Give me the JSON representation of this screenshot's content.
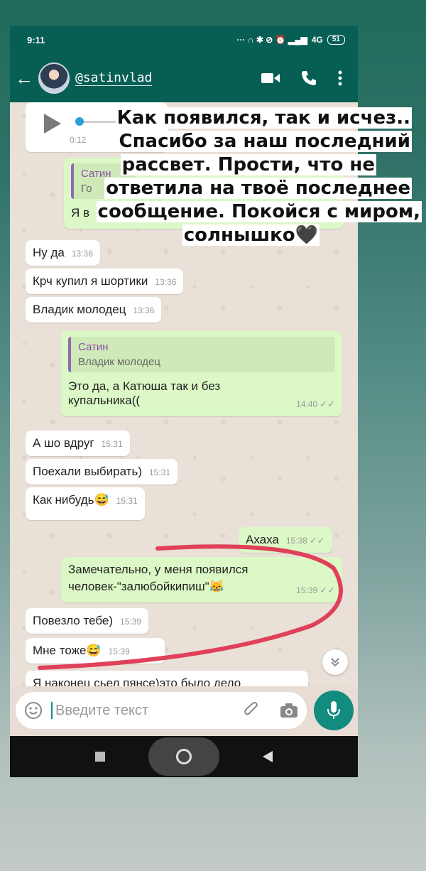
{
  "status": {
    "time": "9:11",
    "network": "4G",
    "battery": "51"
  },
  "header": {
    "contact_name": "@satinvlad"
  },
  "caption": {
    "lines": [
      "Как появился, так и исчез..",
      "Спасибо за наш последний",
      "рассвет. Прости, что не",
      "ответила на твоё последнее",
      "сообщение. Покойся с миром,",
      "солнышко🖤"
    ]
  },
  "voice": {
    "duration": "0:12"
  },
  "partial_quote": {
    "name": "Сатин",
    "snippet": "Го",
    "reply_prefix": "Я в"
  },
  "messages": {
    "m1": {
      "text": "Ну да",
      "time": "13:36"
    },
    "m2": {
      "text": "Крч купил я шортики",
      "time": "13:36"
    },
    "m3": {
      "text": "Владик молодец",
      "time": "13:36"
    },
    "m4": {
      "quote_name": "Сатин",
      "quote_text": "Владик молодец",
      "line1": "Это да, а Катюша так и без",
      "line2": "купальника((",
      "time": "14:40",
      "check": "✓✓"
    },
    "m5": {
      "text": "А шо вдруг",
      "time": "15:31"
    },
    "m6": {
      "text": "Поехали выбирать)",
      "time": "15:31"
    },
    "m7": {
      "text": "Как нибудь😅",
      "time": "15:31"
    },
    "m8": {
      "text": "Ахаха",
      "time": "15:38",
      "check": "✓✓"
    },
    "m9": {
      "line1": "Замечательно, у меня появился",
      "line2": "человек-\"залюбойкипиш\"😹",
      "time": "15:39",
      "check": "✓✓"
    },
    "m10": {
      "text": "Повезло тебе)",
      "time": "15:39"
    },
    "m11": {
      "text": "Мне тоже😅",
      "time": "15:39"
    },
    "m12": {
      "text": "Я наконец сьел пянсе)это было дело"
    }
  },
  "input": {
    "placeholder": "Введите текст"
  },
  "icons": {
    "back": "back-arrow-icon",
    "video": "video-call-icon",
    "phone": "phone-icon",
    "menu": "more-vert-icon",
    "emoji": "emoji-icon",
    "attach": "attach-icon",
    "camera": "camera-icon",
    "mic": "mic-icon",
    "scroll_down": "double-chevron-down-icon",
    "nav_recents": "recents-icon",
    "nav_home": "home-icon",
    "nav_back": "nav-back-icon"
  },
  "colors": {
    "header": "#075e54",
    "outgoing": "#dcf8c6",
    "incoming": "#ffffff",
    "accent": "#128c7e",
    "annotation": "#e0405a"
  }
}
